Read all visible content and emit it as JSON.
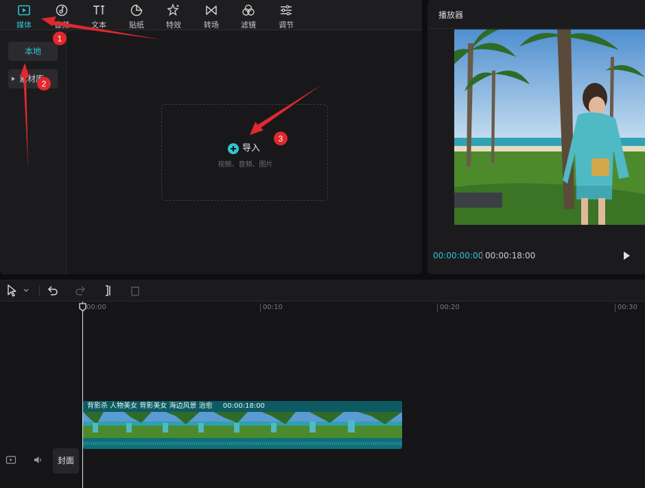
{
  "toolbar": {
    "tabs": [
      {
        "label": "媒体",
        "icon": "media-icon",
        "active": true
      },
      {
        "label": "音频",
        "icon": "audio-icon"
      },
      {
        "label": "文本",
        "icon": "text-icon"
      },
      {
        "label": "贴纸",
        "icon": "sticker-icon"
      },
      {
        "label": "特效",
        "icon": "effects-icon"
      },
      {
        "label": "转场",
        "icon": "transition-icon"
      },
      {
        "label": "滤镜",
        "icon": "filter-icon"
      },
      {
        "label": "调节",
        "icon": "adjust-icon"
      }
    ]
  },
  "sidebar": {
    "local": "本地",
    "material": "素材库"
  },
  "import": {
    "label": "导入",
    "hint": "视频、音频、图片"
  },
  "player": {
    "title": "播放器",
    "current_time": "00:00:00:00",
    "total_time": "00:00:18:00"
  },
  "timeline": {
    "ruler": [
      "00:00",
      "00:10",
      "00:20",
      "00:30"
    ],
    "cover_label": "封面",
    "clip": {
      "title": "背影杀 人物美女 背影美女 海边风景 治愈",
      "duration": "00:00:18:00"
    }
  },
  "annotations": [
    "1",
    "2",
    "3"
  ],
  "colors": {
    "accent": "#2cc7d1",
    "annotation": "#e0282e"
  }
}
